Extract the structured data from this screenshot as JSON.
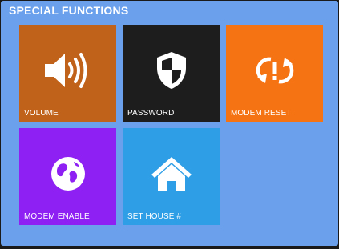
{
  "panel": {
    "title": "SPECIAL FUNCTIONS"
  },
  "tiles": [
    {
      "label": "VOLUME",
      "icon": "speaker-volume-icon",
      "color": "#c1621b"
    },
    {
      "label": "PASSWORD",
      "icon": "shield-icon",
      "color": "#1d1d1d"
    },
    {
      "label": "MODEM RESET",
      "icon": "reset-arrows-icon",
      "color": "#f67313"
    },
    {
      "label": "MODEM ENABLE",
      "icon": "globe-icon",
      "color": "#8e20f3"
    },
    {
      "label": "SET HOUSE #",
      "icon": "home-icon",
      "color": "#2e9ee6"
    }
  ],
  "colors": {
    "background": "#6aa0ec",
    "text": "#ffffff"
  }
}
